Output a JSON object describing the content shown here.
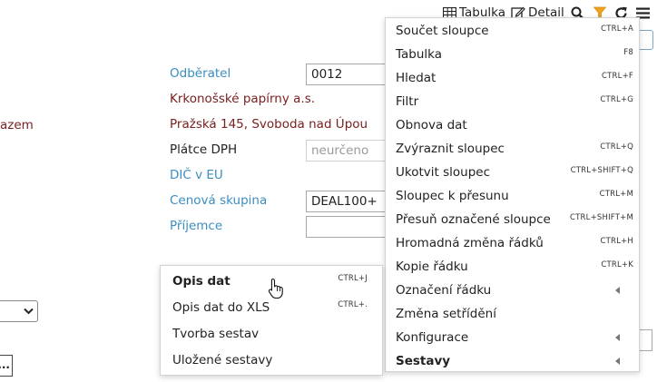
{
  "toolbar": {
    "table_label": "Tabulka",
    "detail_label": "Detail",
    "icons": [
      "table-icon",
      "edit-icon",
      "search-icon",
      "filter-icon",
      "refresh-icon",
      "hamburger-menu-icon"
    ],
    "filter_color": "#f0a21c"
  },
  "form": {
    "left_edge_text": "azem",
    "customer_label": "Odběratel",
    "customer_code": "0012",
    "customer_name": "Krkonošské papírny a.s.",
    "customer_address": "Pražská 145, Svoboda nad Úpou",
    "vat_payer_label": "Plátce DPH",
    "vat_payer_value": "neurčeno",
    "eu_vat_label": "DIČ v EU",
    "price_group_label": "Cenová skupina",
    "price_group_value": "DEAL100+",
    "recipient_label": "Příjemce",
    "recipient_value": "",
    "ellipsis_button": "..."
  },
  "main_menu": {
    "items": [
      {
        "label": "Součet sloupce",
        "shortcut": "CTRL+A"
      },
      {
        "label": "Tabulka",
        "shortcut": "F8"
      },
      {
        "label": "Hledat",
        "shortcut": "CTRL+F"
      },
      {
        "label": "Filtr",
        "shortcut": "CTRL+G"
      },
      {
        "label": "Obnova dat",
        "shortcut": ""
      },
      {
        "label": "Zvýraznit sloupec",
        "shortcut": "CTRL+Q"
      },
      {
        "label": "Ukotvit sloupec",
        "shortcut": "CTRL+SHIFT+Q"
      },
      {
        "label": "Sloupec k přesunu",
        "shortcut": "CTRL+M"
      },
      {
        "label": "Přesuň označené sloupce",
        "shortcut": "CTRL+SHIFT+M"
      },
      {
        "label": "Hromadná změna řádků",
        "shortcut": "CTRL+H"
      },
      {
        "label": "Kopie řádku",
        "shortcut": "CTRL+K"
      },
      {
        "label": "Označení řádku",
        "shortcut": ""
      },
      {
        "label": "Změna setřídění",
        "shortcut": ""
      },
      {
        "label": "Konfigurace",
        "shortcut": ""
      },
      {
        "label": "Sestavy",
        "shortcut": ""
      }
    ]
  },
  "sub_menu": {
    "items": [
      {
        "label": "Opis dat",
        "shortcut": "CTRL+J"
      },
      {
        "label": "Opis dat do XLS",
        "shortcut": "CTRL+."
      },
      {
        "label": "Tvorba sestav",
        "shortcut": ""
      },
      {
        "label": "Uložené sestavy",
        "shortcut": ""
      }
    ]
  }
}
